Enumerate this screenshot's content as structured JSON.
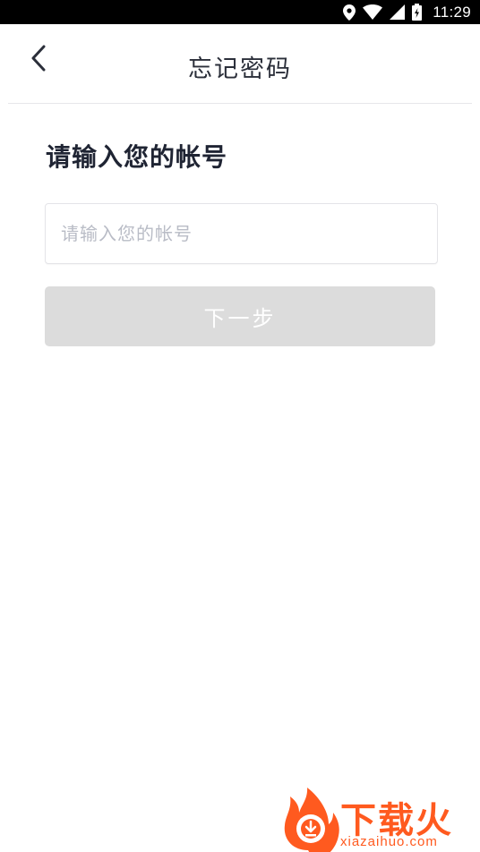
{
  "status_bar": {
    "time": "11:29",
    "icons": [
      "location-icon",
      "wifi-icon",
      "signal-icon",
      "battery-icon"
    ]
  },
  "nav": {
    "title": "忘记密码",
    "back_icon": "chevron-left-icon"
  },
  "form": {
    "heading": "请输入您的帐号",
    "account_placeholder": "请输入您的帐号",
    "account_value": "",
    "next_label": "下一步",
    "next_enabled": false
  },
  "watermark": {
    "brand": "下载火",
    "url": "xiazaihuo.com",
    "icon": "download-flame-icon"
  },
  "colors": {
    "status_bar": "#000000",
    "title_text": "#2b2f3a",
    "heading_text": "#1f2433",
    "placeholder": "#b9bcc6",
    "button_disabled": "#dcdcdc",
    "watermark": "#ff5a1f"
  }
}
